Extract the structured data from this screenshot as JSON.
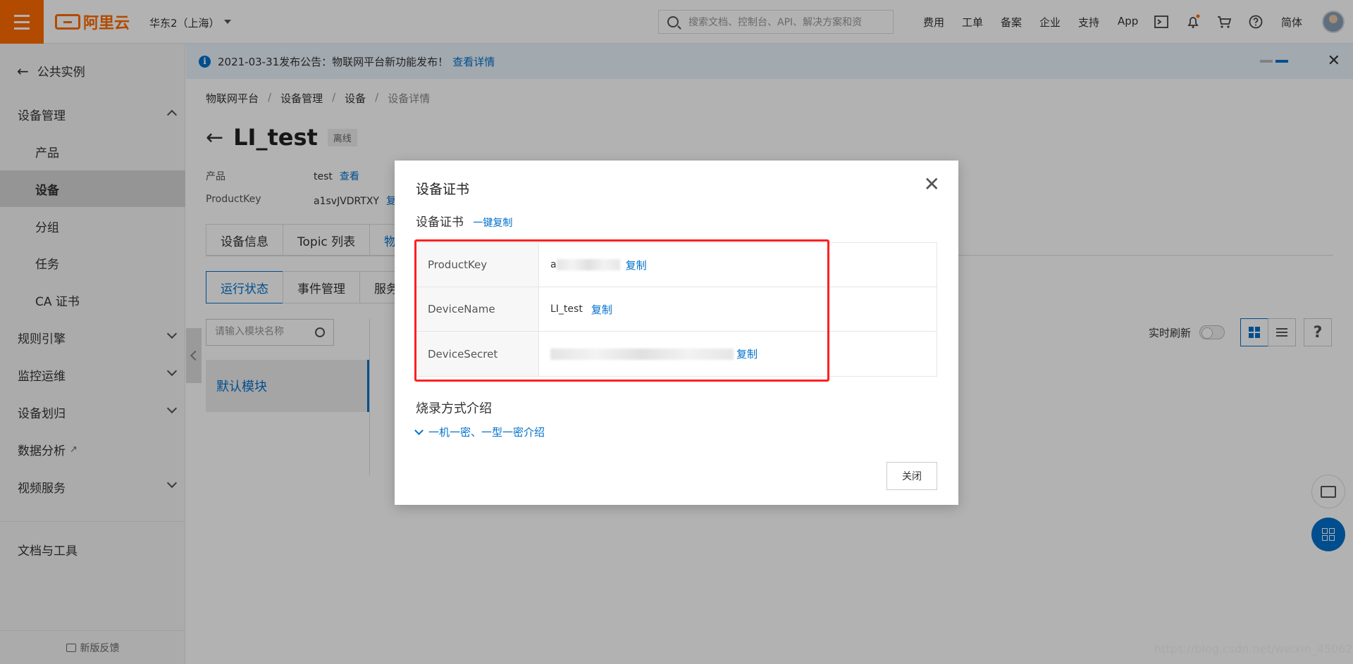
{
  "topbar": {
    "logo_text": "阿里云",
    "region": "华东2（上海）",
    "search_placeholder": "搜索文档、控制台、API、解决方案和资",
    "nav_items": [
      "费用",
      "工单",
      "备案",
      "企业",
      "支持",
      "App"
    ],
    "lang": "简体"
  },
  "sidebar": {
    "back_label": "公共实例",
    "items": [
      {
        "label": "设备管理"
      },
      {
        "label": "产品"
      },
      {
        "label": "设备"
      },
      {
        "label": "分组"
      },
      {
        "label": "任务"
      },
      {
        "label": "CA 证书"
      },
      {
        "label": "规则引擎"
      },
      {
        "label": "监控运维"
      },
      {
        "label": "设备划归"
      },
      {
        "label": "数据分析"
      },
      {
        "label": "视频服务"
      },
      {
        "label": "文档与工具"
      }
    ],
    "feedback": "新版反馈"
  },
  "notice": {
    "text": "2021-03-31发布公告：物联网平台新功能发布！",
    "link": "查看详情"
  },
  "breadcrumb": [
    "物联网平台",
    "设备管理",
    "设备",
    "设备详情"
  ],
  "device": {
    "name": "LI_test",
    "status": "离线",
    "product_label": "产品",
    "product_value": "test",
    "product_link": "查看",
    "productkey_label": "ProductKey",
    "productkey_value": "a1svJVDRTXY",
    "productkey_link": "复"
  },
  "tabs": [
    "设备信息",
    "Topic 列表",
    "物"
  ],
  "subtabs": [
    "运行状态",
    "事件管理",
    "服务"
  ],
  "module_search_placeholder": "请输入模块名称",
  "module_default": "默认模块",
  "realtime_refresh_label": "实时刷新",
  "help_label": "?",
  "modal": {
    "title": "设备证书",
    "section_title": "设备证书",
    "copy_all": "一键复制",
    "rows": [
      {
        "key": "ProductKey",
        "value": "a",
        "copy": "复制"
      },
      {
        "key": "DeviceName",
        "value": "LI_test",
        "copy": "复制"
      },
      {
        "key": "DeviceSecret",
        "value": "",
        "copy": "复制"
      }
    ],
    "burn_title": "烧录方式介绍",
    "burn_link": "一机一密、一型一密介绍",
    "close_label": "关闭"
  },
  "watermark": "https://blog.csdn.net/weixin_45062087",
  "colors": {
    "accent": "#0070cc",
    "brand": "#ff6a00",
    "highlight": "#ff2020"
  }
}
